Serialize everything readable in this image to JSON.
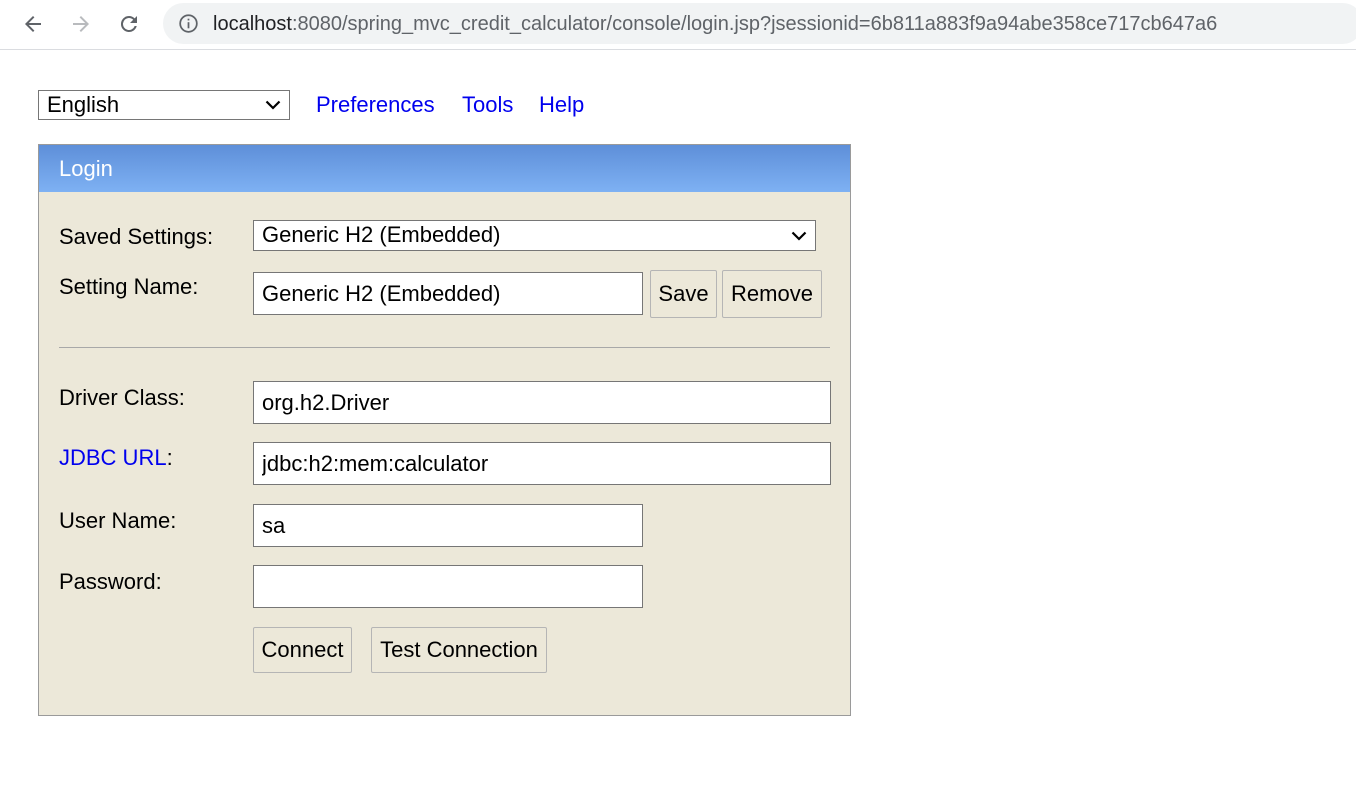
{
  "browser": {
    "url_host": "localhost",
    "url_rest": ":8080/spring_mvc_credit_calculator/console/login.jsp?jsessionid=6b811a883f9a94abe358ce717cb647a6"
  },
  "toolbar": {
    "language": "English",
    "links": [
      "Preferences",
      "Tools",
      "Help"
    ]
  },
  "login": {
    "title": "Login",
    "saved_settings_label": "Saved Settings:",
    "saved_settings_value": "Generic H2 (Embedded)",
    "setting_name_label": "Setting Name:",
    "setting_name_value": "Generic H2 (Embedded)",
    "save_label": "Save",
    "remove_label": "Remove",
    "driver_class_label": "Driver Class:",
    "driver_class_value": "org.h2.Driver",
    "jdbc_url_link": "JDBC URL",
    "jdbc_url_colon": ":",
    "jdbc_url_value": "jdbc:h2:mem:calculator",
    "user_name_label": "User Name:",
    "user_name_value": "sa",
    "password_label": "Password:",
    "password_value": "",
    "connect_label": "Connect",
    "test_connection_label": "Test Connection"
  },
  "colors": {
    "panel_bg": "#ece8d9",
    "header_gradient_top": "#5e8fd9",
    "header_gradient_bottom": "#7eb1f3",
    "link": "#0000ee"
  }
}
